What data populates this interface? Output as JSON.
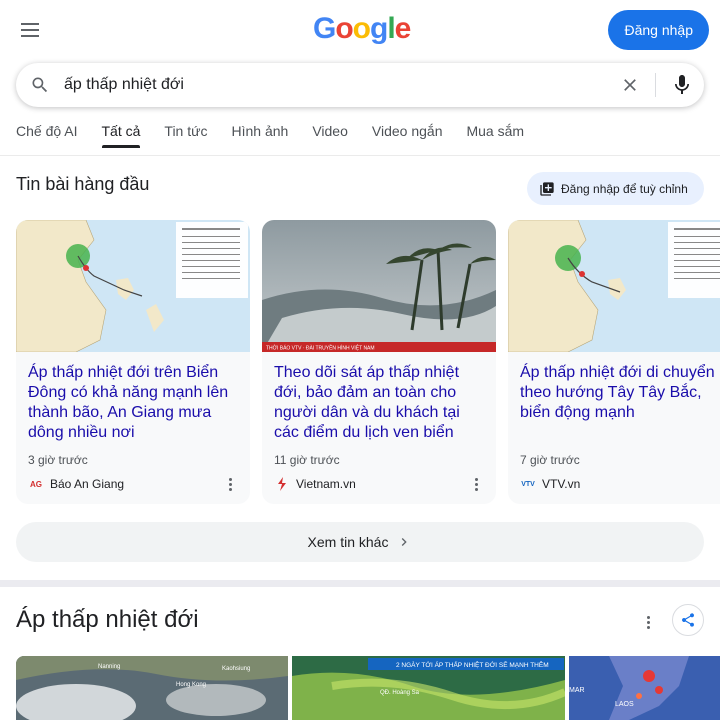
{
  "header": {
    "logo_text": "Google",
    "signin_label": "Đăng nhập"
  },
  "search": {
    "query": "ấp thấp nhiệt đới"
  },
  "tabs": [
    {
      "label": "Chế độ AI",
      "active": false
    },
    {
      "label": "Tất cả",
      "active": true
    },
    {
      "label": "Tin tức",
      "active": false
    },
    {
      "label": "Hình ảnh",
      "active": false
    },
    {
      "label": "Video",
      "active": false
    },
    {
      "label": "Video ngắn",
      "active": false
    },
    {
      "label": "Mua sắm",
      "active": false
    }
  ],
  "top_stories": {
    "title": "Tin bài hàng đầu",
    "personalize_label": "Đăng nhập để tuỳ chỉnh",
    "cards": [
      {
        "title": "Áp thấp nhiệt đới trên Biển Đông có khả năng mạnh lên thành bão, An Giang mưa dông nhiều nơi",
        "time": "3 giờ trước",
        "source": "Báo An Giang",
        "source_logo": "AG"
      },
      {
        "title": "Theo dõi sát áp thấp nhiệt đới, bảo đảm an toàn cho người dân và du khách tại các điểm du lịch ven biển",
        "time": "11 giờ trước",
        "source": "Vietnam.vn",
        "source_logo": "",
        "image_caption": "THỜI BÁO VTV · ĐÀI TRUYỀN HÌNH VIỆT NAM"
      },
      {
        "title": "Áp thấp nhiệt đới di chuyển theo hướng Tây Tây Bắc, biển động mạnh",
        "time": "7 giờ trước",
        "source": "VTV.vn",
        "source_logo": "VTV"
      }
    ],
    "more_label": "Xem tin khác"
  },
  "knowledge_panel": {
    "title": "Áp thấp nhiệt đới",
    "images": [
      {
        "labels": [
          "Nanning",
          "Kaohsiung",
          "Hong Kong"
        ]
      },
      {
        "labels": [
          "2 NGÀY TỚI ÁP THẤP NHIỆT ĐỚI SẼ MẠNH THÊM",
          "QĐ. Hoàng Sa"
        ]
      },
      {
        "labels": [
          "MAR",
          "LAOS"
        ]
      }
    ]
  },
  "colors": {
    "accent": "#1a73e8",
    "link": "#1a0dab",
    "card_bg": "#f8f9fa"
  }
}
